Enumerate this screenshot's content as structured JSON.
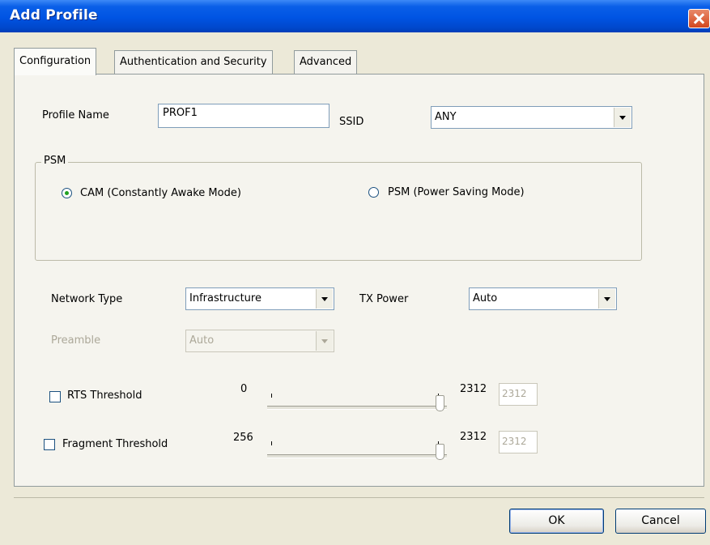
{
  "window": {
    "title": "Add Profile"
  },
  "tabs": [
    {
      "label": "Configuration"
    },
    {
      "label": "Authentication and Security"
    },
    {
      "label": "Advanced"
    }
  ],
  "profile_name": {
    "label": "Profile Name",
    "value": "PROF1"
  },
  "ssid": {
    "label": "SSID",
    "value": "ANY"
  },
  "psm": {
    "caption": "PSM",
    "cam_label": "CAM (Constantly Awake Mode)",
    "psm_label": "PSM (Power Saving Mode)",
    "selected": "CAM"
  },
  "network_type": {
    "label": "Network Type",
    "value": "Infrastructure"
  },
  "tx_power": {
    "label": "TX Power",
    "value": "Auto"
  },
  "preamble": {
    "label": "Preamble",
    "value": "Auto"
  },
  "rts": {
    "label": "RTS Threshold",
    "checked": false,
    "min": "0",
    "max": "2312",
    "value": "2312"
  },
  "fragment": {
    "label": "Fragment Threshold",
    "checked": false,
    "min": "256",
    "max": "2312",
    "value": "2312"
  },
  "buttons": {
    "ok": "OK",
    "cancel": "Cancel"
  },
  "colors": {
    "title_bar": "#0054e3",
    "dialog_bg": "#ece9d8",
    "close_button": "#d3461e"
  }
}
